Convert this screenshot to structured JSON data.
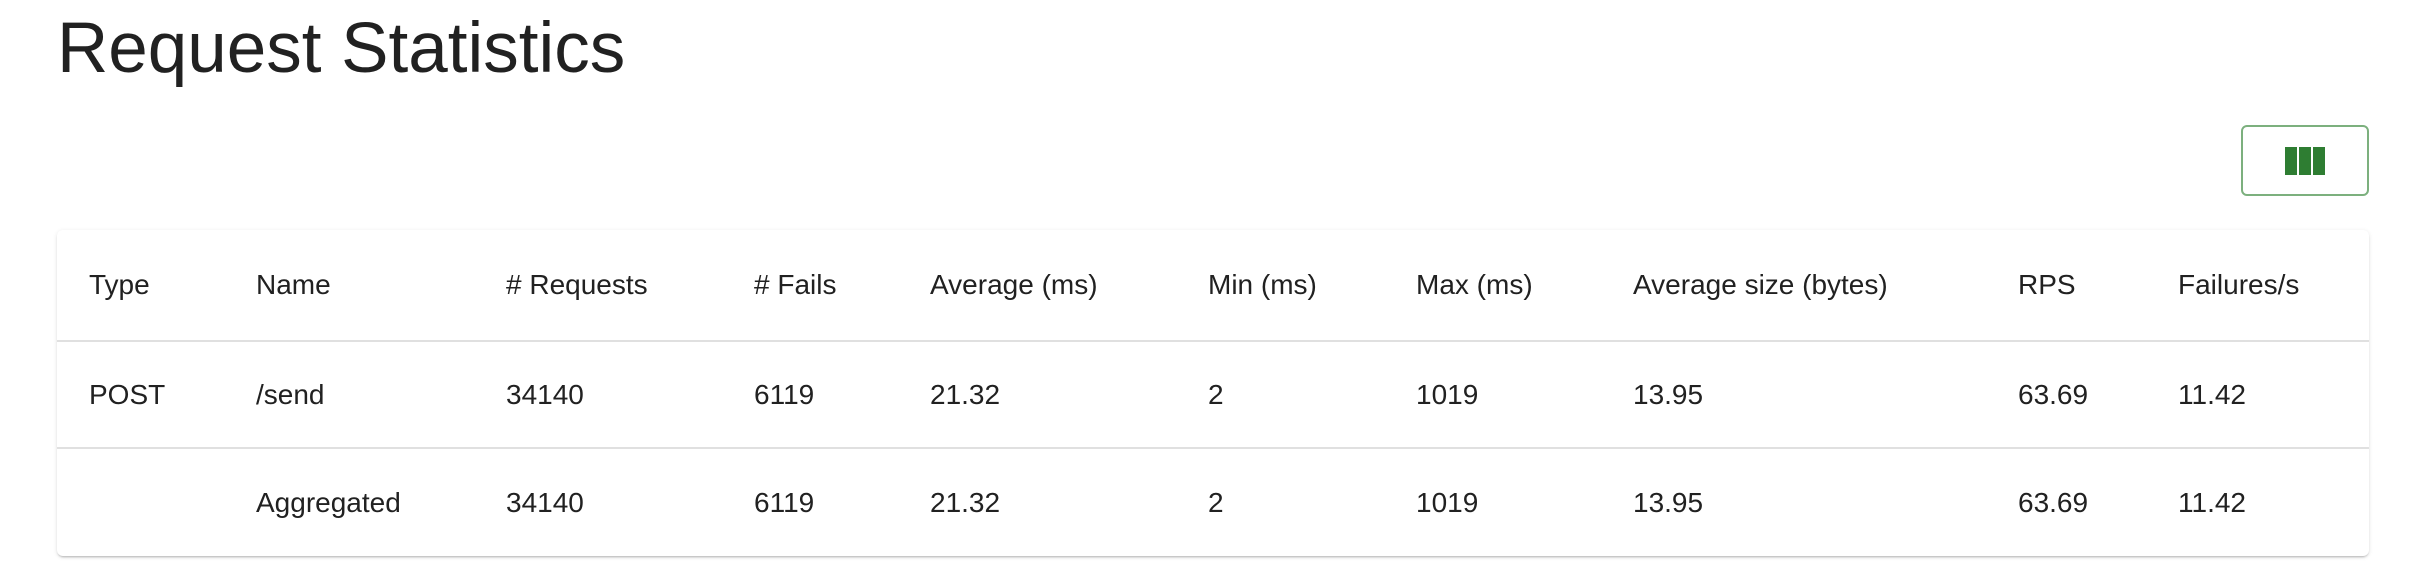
{
  "page": {
    "title": "Request Statistics"
  },
  "toolbar": {
    "columns_button_icon": "view-column-icon",
    "accent_color": "#2e7d32"
  },
  "table": {
    "headers": {
      "type": "Type",
      "name": "Name",
      "requests": "# Requests",
      "fails": "# Fails",
      "average": "Average (ms)",
      "min": "Min (ms)",
      "max": "Max (ms)",
      "avg_size": "Average size (bytes)",
      "rps": "RPS",
      "failures_per_s": "Failures/s"
    },
    "rows": [
      {
        "type": "POST",
        "name": "/send",
        "requests": "34140",
        "fails": "6119",
        "average": "21.32",
        "min": "2",
        "max": "1019",
        "avg_size": "13.95",
        "rps": "63.69",
        "failures_per_s": "11.42"
      },
      {
        "type": "",
        "name": "Aggregated",
        "requests": "34140",
        "fails": "6119",
        "average": "21.32",
        "min": "2",
        "max": "1019",
        "avg_size": "13.95",
        "rps": "63.69",
        "failures_per_s": "11.42"
      }
    ]
  }
}
